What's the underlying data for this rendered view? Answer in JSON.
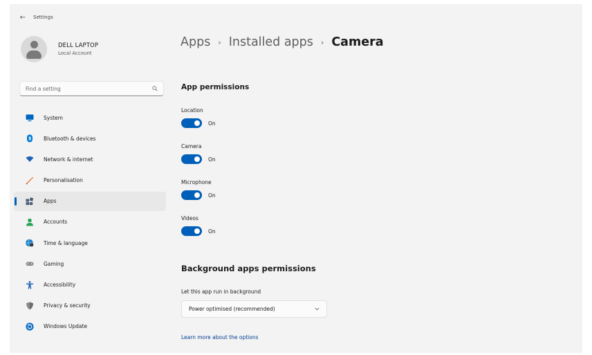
{
  "window": {
    "title": "Settings"
  },
  "profile": {
    "name": "DELL LAPTOP",
    "account_type": "Local Account"
  },
  "search": {
    "placeholder": "Find a setting",
    "icon": "search-icon"
  },
  "sidebar": {
    "items": [
      {
        "label": "System",
        "icon": "monitor-icon",
        "color": "#0067c0",
        "active": false
      },
      {
        "label": "Bluetooth & devices",
        "icon": "bluetooth-icon",
        "color": "#0078d4",
        "active": false
      },
      {
        "label": "Network & internet",
        "icon": "wifi-icon",
        "color": "#1e62b8",
        "active": false
      },
      {
        "label": "Personalisation",
        "icon": "brush-icon",
        "color": "#e0732a",
        "active": false
      },
      {
        "label": "Apps",
        "icon": "apps-icon",
        "color": "#4a5a78",
        "active": true
      },
      {
        "label": "Accounts",
        "icon": "person-icon",
        "color": "#2aa35a",
        "active": false
      },
      {
        "label": "Time & language",
        "icon": "globe-clock-icon",
        "color": "#1c7fc9",
        "active": false
      },
      {
        "label": "Gaming",
        "icon": "gamepad-icon",
        "color": "#777777",
        "active": false
      },
      {
        "label": "Accessibility",
        "icon": "accessibility-icon",
        "color": "#1a5fb4",
        "active": false
      },
      {
        "label": "Privacy & security",
        "icon": "shield-icon",
        "color": "#8a8a8a",
        "active": false
      },
      {
        "label": "Windows Update",
        "icon": "update-icon",
        "color": "#1670c6",
        "active": false
      }
    ]
  },
  "breadcrumb": {
    "level1": "Apps",
    "level2": "Installed apps",
    "current": "Camera",
    "separator": "›"
  },
  "app_permissions": {
    "heading": "App permissions",
    "items": [
      {
        "label": "Location",
        "state": "On",
        "enabled": true
      },
      {
        "label": "Camera",
        "state": "On",
        "enabled": true
      },
      {
        "label": "Microphone",
        "state": "On",
        "enabled": true
      },
      {
        "label": "Videos",
        "state": "On",
        "enabled": true
      }
    ]
  },
  "background": {
    "heading": "Background apps permissions",
    "label": "Let this app run in background",
    "selected": "Power optimised (recommended)"
  },
  "learn_more": "Learn more about the options",
  "colors": {
    "accent": "#005fb8",
    "link": "#003e92",
    "window_bg": "#f3f3f3"
  }
}
